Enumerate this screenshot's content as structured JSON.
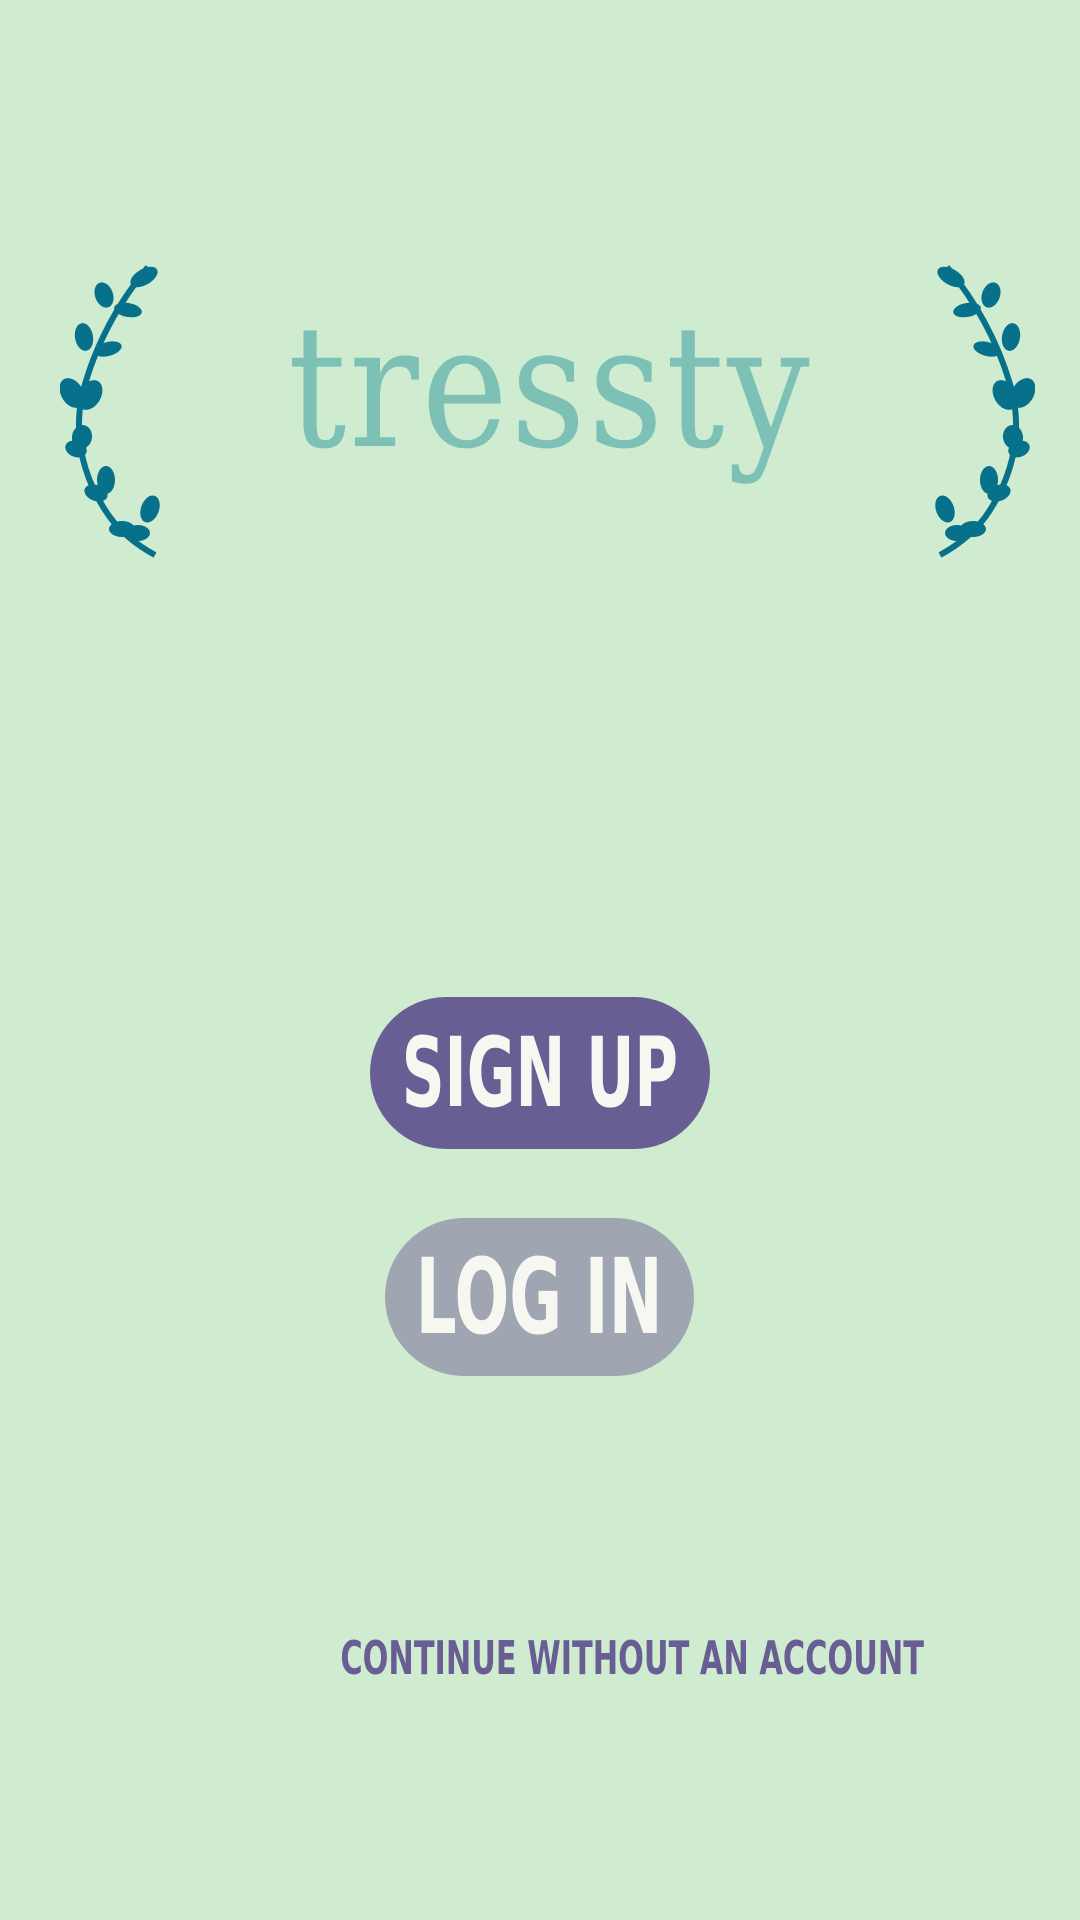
{
  "colors": {
    "background": "#d0ecd0",
    "logo_text": "#7dc0b6",
    "laurel": "#07708a",
    "primary": "#695e94",
    "secondary": "#9fa5b1",
    "button_text": "#f7f7f2"
  },
  "logo": {
    "app_name": "tressty",
    "left_icon": "laurel-branch-icon",
    "right_icon": "laurel-branch-icon"
  },
  "actions": {
    "sign_up_label": "SIGN UP",
    "log_in_label": "LOG IN",
    "guest_label": "CONTINUE WITHOUT AN ACCOUNT"
  }
}
